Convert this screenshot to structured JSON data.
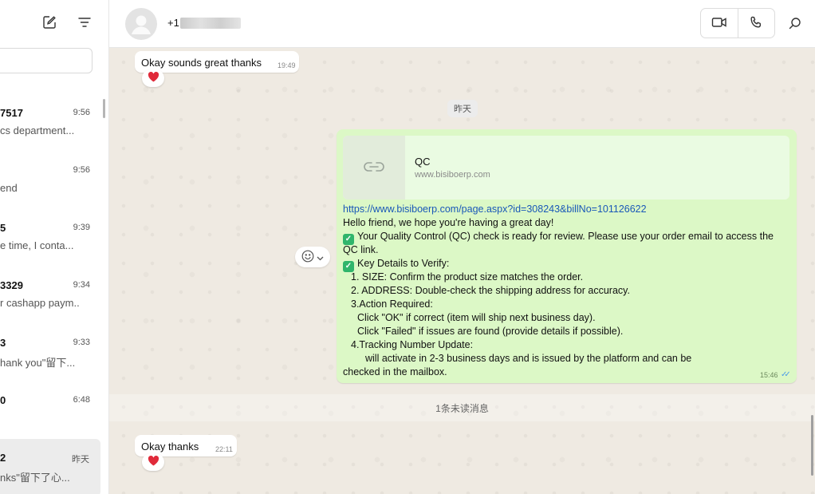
{
  "sidebar": {
    "new_chat_icon": "compose-icon",
    "filter_icon": "filter-icon",
    "search_placeholder": "",
    "chats": [
      {
        "name": "7517",
        "time": "9:56",
        "preview": "cs department..."
      },
      {
        "name": "",
        "time": "9:56",
        "preview": "end"
      },
      {
        "name": "5",
        "time": "9:39",
        "preview": "e time, I conta..."
      },
      {
        "name": "3329",
        "time": "9:34",
        "preview": "r cashapp paym..."
      },
      {
        "name": "3",
        "time": "9:33",
        "preview": "hank you\"留下..."
      },
      {
        "name": "0",
        "time": "6:48",
        "preview": ""
      },
      {
        "name": "2",
        "time": "昨天",
        "preview": "nks\"留下了心..."
      }
    ]
  },
  "header": {
    "contact_name": "+1",
    "video_icon": "video-call-icon",
    "voice_icon": "phone-icon",
    "search_icon": "search-icon"
  },
  "messages": {
    "msg1": {
      "text": "Okay sounds great thanks",
      "time": "19:49",
      "reaction": "❤️"
    },
    "date_divider": "昨天",
    "outgoing": {
      "preview_title": "QC",
      "preview_domain": "www.bisiboerp.com",
      "link": "https://www.bisiboerp.com/page.aspx?id=308243&billNo=101126622",
      "line1": "Hello friend, we hope you're having a great day!",
      "line2a": "Your Quality Control (QC) check is ready for review. Please use your order email to access the",
      "line2b": "QC link.",
      "line3": "Key Details to Verify:",
      "line4": "1. SIZE: Confirm the product size matches the order.",
      "line5": "2. ADDRESS: Double-check the shipping address for accuracy.",
      "line6": "3.Action Required:",
      "line7": "Click \"OK\" if correct (item will ship next business day).",
      "line8": "Click \"Failed\" if issues are found (provide details if possible).",
      "line9": "4.Tracking Number Update:",
      "line10": "will activate in 2-3 business days and is issued by the platform and can be",
      "line11": "checked in the mailbox.",
      "time": "15:46",
      "ticks": "✓✓"
    },
    "unread_divider": "1条未读消息",
    "msg2": {
      "text": "Okay thanks",
      "time": "22:11",
      "reaction": "❤️"
    }
  },
  "colors": {
    "outgoing_bubble": "#dcf8c6",
    "link": "#1a58b8",
    "read_ticks": "#4a9be8",
    "check_emoji": "#2fb56b"
  }
}
